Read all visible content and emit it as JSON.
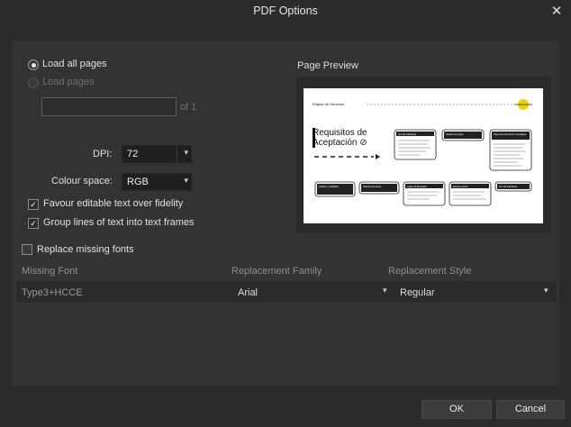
{
  "window": {
    "title": "PDF Options",
    "close_glyph": "✕"
  },
  "load": {
    "all_pages_label": "Load all pages",
    "pages_label": "Load pages",
    "pages_value": "",
    "of_label": "of 1"
  },
  "dpi": {
    "label": "DPI:",
    "value": "72"
  },
  "colour_space": {
    "label": "Colour space:",
    "value": "RGB"
  },
  "options": {
    "favour_editable": "Favour editable text over fidelity",
    "group_lines": "Group lines of text into text frames",
    "replace_fonts": "Replace missing fonts"
  },
  "preview": {
    "label": "Page Preview",
    "doc": {
      "header": "Etapas de Servicios",
      "title_line1": "Requisitos de",
      "title_line2": "Aceptación ⊘",
      "box_top": [
        "Voz del solicitante",
        "Gestión de oferta",
        "Diferencia del hecho Investigado"
      ],
      "box_bottom": [
        "Análisis y viabilidad",
        "Solicitud de apoyo",
        "Lugar de Expresión",
        "Entorno clínico",
        "Voz del solicitante"
      ]
    }
  },
  "table": {
    "headers": [
      "Missing Font",
      "Replacement Family",
      "Replacement Style"
    ],
    "rows": [
      {
        "missing": "Type3+HCCE",
        "family": "Arial",
        "style": "Regular"
      }
    ]
  },
  "buttons": {
    "ok": "OK",
    "cancel": "Cancel"
  },
  "icons": {
    "dropdown": "chevron-down-icon",
    "check": "checkmark-icon"
  },
  "colors": {
    "dialog_bg": "#2b2b2b",
    "panel_bg": "#333333",
    "field_bg": "#1f1f1f",
    "preview_accent": "#f2d200"
  }
}
